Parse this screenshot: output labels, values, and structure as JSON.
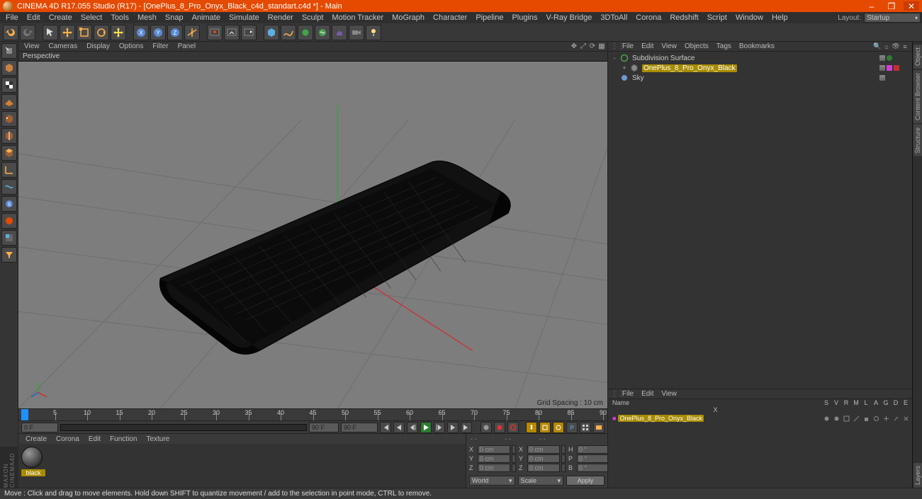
{
  "title": "CINEMA 4D R17.055 Studio (R17) - [OnePlus_8_Pro_Onyx_Black_c4d_standart.c4d *] - Main",
  "window_buttons": {
    "min": "–",
    "max": "❐",
    "close": "✕"
  },
  "menu": [
    "File",
    "Edit",
    "Create",
    "Select",
    "Tools",
    "Mesh",
    "Snap",
    "Animate",
    "Simulate",
    "Render",
    "Sculpt",
    "Motion Tracker",
    "MoGraph",
    "Character",
    "Pipeline",
    "Plugins",
    "V-Ray Bridge",
    "3DToAll",
    "Corona",
    "Redshift",
    "Script",
    "Window",
    "Help"
  ],
  "layout": {
    "label": "Layout:",
    "value": "Startup"
  },
  "view_menu": [
    "View",
    "Cameras",
    "Display",
    "Options",
    "Filter",
    "Panel"
  ],
  "view_label": "Perspective",
  "grid_spacing": "Grid Spacing : 10 cm",
  "timeline": {
    "start": 0,
    "end": 90,
    "major_every": 5,
    "unit": "F"
  },
  "anim": {
    "start_field": "0 F",
    "slider_start": "0 F",
    "slider_end": "90 F",
    "end_field": "90 F"
  },
  "mat_menu": [
    "Create",
    "Corona",
    "Edit",
    "Function",
    "Texture"
  ],
  "materials": [
    {
      "name": "black"
    }
  ],
  "obj_menu": [
    "File",
    "Edit",
    "View",
    "Objects",
    "Tags",
    "Bookmarks"
  ],
  "objects": [
    {
      "name": "Subdivision Surface",
      "icon": "subdiv",
      "depth": 0,
      "expand": "-",
      "tags": [
        "vis",
        "green"
      ]
    },
    {
      "name": "OnePlus_8_Pro_Onyx_Black",
      "icon": "poly",
      "depth": 1,
      "expand": "+",
      "selected": true,
      "tags": [
        "vis",
        "mag",
        "red"
      ]
    },
    {
      "name": "Sky",
      "icon": "sky",
      "depth": 0,
      "expand": "",
      "tags": [
        "vis"
      ]
    }
  ],
  "attr_menu": [
    "File",
    "Edit",
    "View"
  ],
  "attr_cols": [
    "Name",
    "S",
    "V",
    "R",
    "M",
    "L",
    "A",
    "G",
    "D",
    "E",
    "X"
  ],
  "attr_item": {
    "name": "OnePlus_8_Pro_Onyx_Black"
  },
  "coord": {
    "headers": [
      "- -",
      "- -",
      "- -"
    ],
    "rows": [
      {
        "a": "X",
        "av": "0 cm",
        "b": "X",
        "bv": "0 cm",
        "c": "H",
        "cv": "0 °"
      },
      {
        "a": "Y",
        "av": "0 cm",
        "b": "Y",
        "bv": "0 cm",
        "c": "P",
        "cv": "0 °"
      },
      {
        "a": "Z",
        "av": "0 cm",
        "b": "Z",
        "bv": "0 cm",
        "c": "B",
        "cv": "0 °"
      }
    ],
    "dd1": "World",
    "dd2": "Scale",
    "apply": "Apply"
  },
  "vtabs": [
    "Object",
    "Content Browser",
    "Structure",
    "Layers"
  ],
  "brand": "MAXON CINEMA4D",
  "status": "Move : Click and drag to move elements. Hold down SHIFT to quantize movement / add to the selection in point mode, CTRL to remove."
}
